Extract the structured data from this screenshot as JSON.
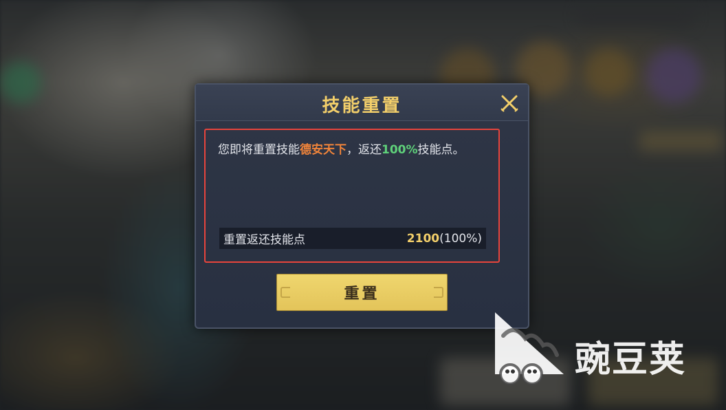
{
  "dialog": {
    "title": "技能重置",
    "message": {
      "prefix": "您即将重置技能",
      "skill_name": "德安天下",
      "middle": "，返还",
      "percent": "100%",
      "suffix": "技能点。"
    },
    "refund": {
      "label": "重置返还技能点",
      "amount": "2100",
      "percent_text": "(100%)"
    },
    "reset_button_label": "重置"
  },
  "watermark": {
    "text": "豌豆荚"
  },
  "colors": {
    "title": "#f3cf6a",
    "skill_name": "#f0843a",
    "percent": "#5fd17a",
    "highlight_border": "#e8443c",
    "button": "#e9cd62"
  },
  "icons": {
    "close": "close-x-icon",
    "watermark_logo": "wandoujia-logo-icon"
  }
}
